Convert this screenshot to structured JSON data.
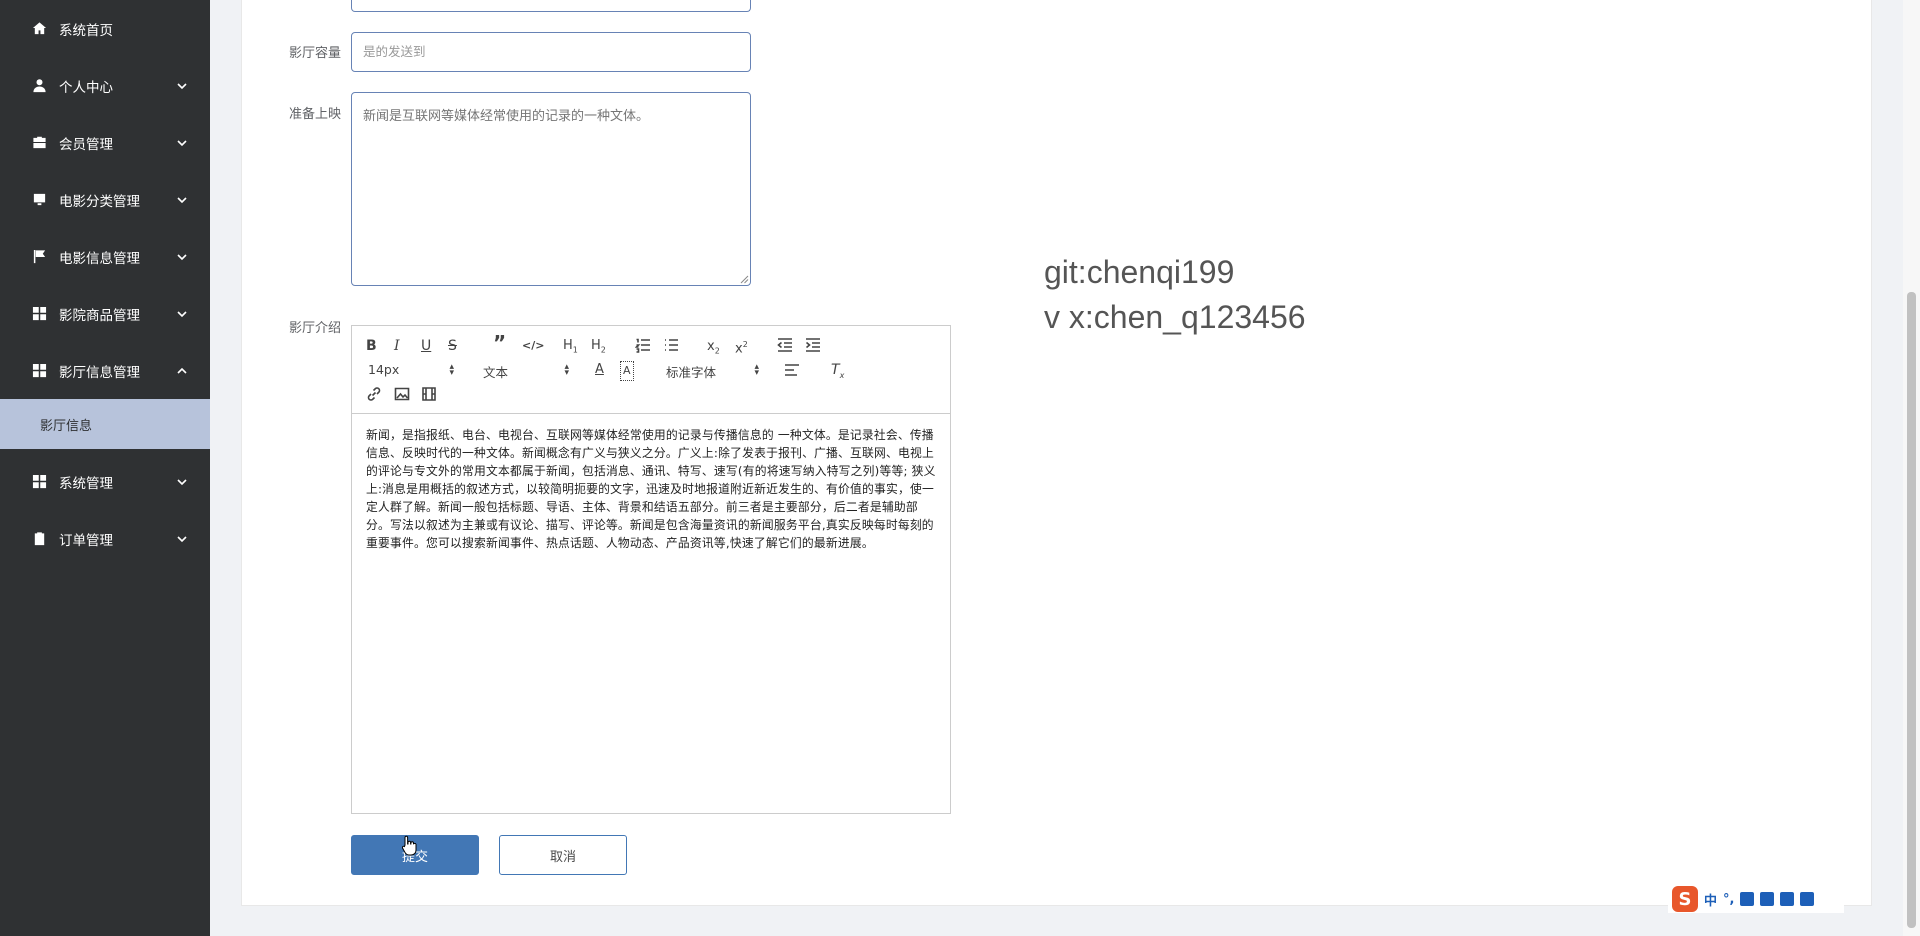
{
  "sidebar": {
    "items": [
      {
        "label": "系统首页",
        "icon": "home-icon"
      },
      {
        "label": "个人中心",
        "icon": "user-icon"
      },
      {
        "label": "会员管理",
        "icon": "briefcase-icon"
      },
      {
        "label": "电影分类管理",
        "icon": "monitor-icon"
      },
      {
        "label": "电影信息管理",
        "icon": "flag-icon"
      },
      {
        "label": "影院商品管理",
        "icon": "grid-icon"
      },
      {
        "label": "影厅信息管理",
        "icon": "grid-icon"
      },
      {
        "label": "系统管理",
        "icon": "grid-icon"
      },
      {
        "label": "订单管理",
        "icon": "clipboard-icon"
      }
    ],
    "active_sub": "影厅信息"
  },
  "form": {
    "capacity_label": "影厅容量",
    "capacity_value": "是的发送到",
    "release_label": "准备上映",
    "release_placeholder": "新闻是互联网等媒体经常使用的记录的一种文体。",
    "intro_label": "影厅介绍"
  },
  "editor": {
    "font_size": "14px",
    "block_type": "文本",
    "font_family": "标准字体",
    "content": "新闻，是指报纸、电台、电视台、互联网等媒体经常使用的记录与传播信息的 一种文体。是记录社会、传播信息、反映时代的一种文体。新闻概念有广义与狭义之分。广义上:除了发表于报刊、广播、互联网、电视上的评论与专文外的常用文本都属于新闻，包括消息、通讯、特写、速写(有的将速写纳入特写之列)等等; 狭义上:消息是用概括的叙述方式，以较简明扼要的文字，迅速及时地报道附近新近发生的、有价值的事实，使一定人群了解。新闻一般包括标题、导语、主体、背景和结语五部分。前三者是主要部分，后二者是辅助部分。写法以叙述为主兼或有议论、描写、评论等。新闻是包含海量资讯的新闻服务平台,真实反映每时每刻的重要事件。您可以搜索新闻事件、热点话题、人物动态、产品资讯等,快速了解它们的最新进展。"
  },
  "buttons": {
    "submit": "提交",
    "cancel": "取消"
  },
  "watermark": {
    "line1": "git:chenqi199",
    "line2": "v x:chen_q123456"
  },
  "ime": {
    "logo": "S",
    "mode": "中",
    "punct": "°,"
  }
}
